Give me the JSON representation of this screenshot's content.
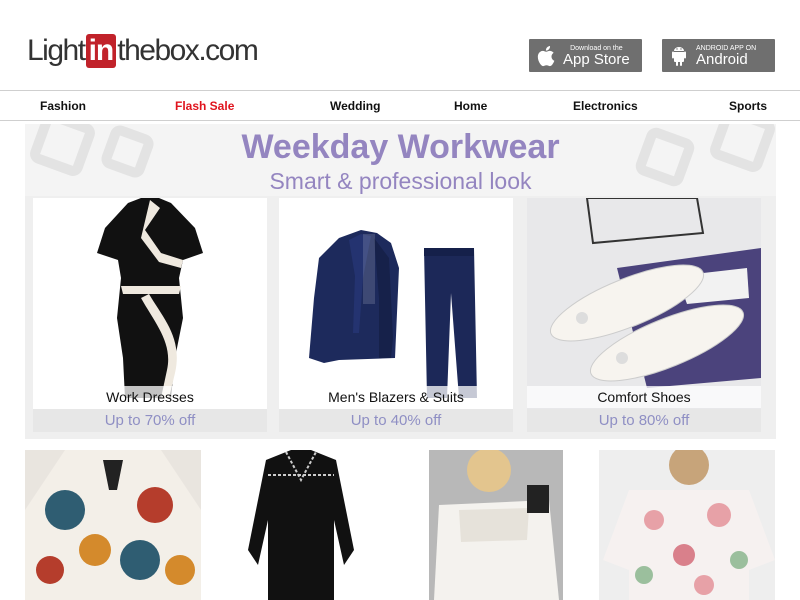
{
  "header": {
    "logo": {
      "part1": "Light",
      "part2": "in",
      "part3": "thebox",
      "part4": ".com"
    },
    "app_store": {
      "small": "Download on the",
      "big": "App Store",
      "icon": "apple-icon"
    },
    "android": {
      "small": "ANDROID APP ON",
      "big": "Android",
      "icon": "android-icon"
    }
  },
  "nav": {
    "items": [
      "Fashion",
      "Flash Sale",
      "Wedding",
      "Home",
      "Electronics",
      "Sports"
    ]
  },
  "banner": {
    "title": "Weekday Workwear",
    "subtitle": "Smart & professional look",
    "cards": [
      {
        "caption": "Work Dresses",
        "discount": "Up to 70% off"
      },
      {
        "caption": "Men's Blazers & Suits",
        "discount": "Up to 40% off"
      },
      {
        "caption": "Comfort Shoes",
        "discount": "Up to 80% off"
      }
    ]
  },
  "colors": {
    "brand_red": "#c1222a",
    "flash_sale": "#e0141e",
    "banner_text": "#9485c0",
    "button_gray": "#6f6f6f"
  }
}
